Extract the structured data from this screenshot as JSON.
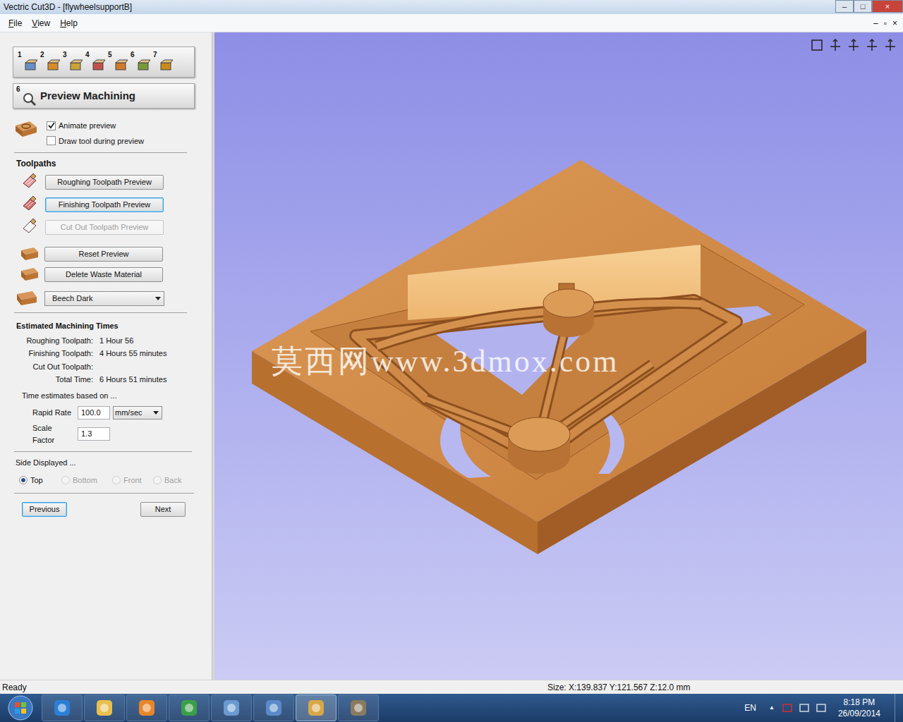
{
  "window": {
    "title": "Vectric Cut3D - [flywheelsupportB]",
    "controls": [
      "–",
      "□",
      "×"
    ]
  },
  "menu": [
    "File",
    "View",
    "Help"
  ],
  "mdi_controls": [
    "–",
    "▫",
    "×"
  ],
  "steps": [
    "1",
    "2",
    "3",
    "4",
    "5",
    "6",
    "7"
  ],
  "panel": {
    "step": "6",
    "title": "Preview Machining"
  },
  "options": [
    {
      "label": "Animate preview",
      "checked": true
    },
    {
      "label": "Draw tool during preview",
      "checked": false
    }
  ],
  "toolpaths": {
    "heading": "Toolpaths",
    "buttons": [
      {
        "label": "Roughing Toolpath Preview",
        "focused": false,
        "disabled": false
      },
      {
        "label": "Finishing Toolpath Preview",
        "focused": true,
        "disabled": false
      },
      {
        "label": "Cut Out Toolpath Preview",
        "focused": false,
        "disabled": true
      }
    ]
  },
  "actions": [
    "Reset Preview",
    "Delete Waste Material"
  ],
  "material": {
    "value": "Beech Dark"
  },
  "times": {
    "heading": "Estimated Machining Times",
    "rows": [
      {
        "label": "Roughing Toolpath:",
        "value": "1 Hour 56"
      },
      {
        "label": "Finishing Toolpath:",
        "value": "4 Hours 55 minutes"
      },
      {
        "label": "Cut Out Toolpath:",
        "value": ""
      },
      {
        "label": "Total Time:",
        "value": "6 Hours 51 minutes"
      }
    ],
    "note": "Time estimates based on ..."
  },
  "rapid_rate": {
    "label": "Rapid Rate",
    "value": "100.0",
    "unit": "mm/sec"
  },
  "scale_factor": {
    "label": "Scale Factor",
    "value": "1.3"
  },
  "side": {
    "heading": "Side Displayed ...",
    "options": [
      {
        "label": "Top",
        "selected": true,
        "disabled": false
      },
      {
        "label": "Bottom",
        "selected": false,
        "disabled": true
      },
      {
        "label": "Front",
        "selected": false,
        "disabled": true
      },
      {
        "label": "Back",
        "selected": false,
        "disabled": true
      }
    ]
  },
  "nav": [
    {
      "label": "Previous",
      "focused": true
    },
    {
      "label": "Next",
      "focused": false
    }
  ],
  "watermark": "莫西网www.3dmox.com",
  "status_bar": {
    "left": "Ready",
    "size": "Size: X:139.837 Y:121.567 Z:12.0 mm"
  },
  "taskbar": {
    "language": "EN",
    "tray_arrow": "▲",
    "time": "8:18 PM",
    "date": "26/09/2014"
  }
}
